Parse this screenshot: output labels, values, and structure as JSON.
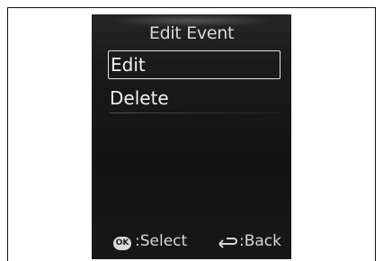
{
  "screen": {
    "title": "Edit Event",
    "menu": [
      {
        "label": "Edit",
        "selected": true
      },
      {
        "label": "Delete",
        "selected": false
      }
    ],
    "footer": {
      "ok_icon_text": "OK",
      "select_label": ":Select",
      "back_label": ":Back"
    }
  },
  "icons": [
    "ok-button-icon",
    "back-arrow-icon"
  ],
  "colors": {
    "screen_bg": "#171717",
    "text": "#f2f2f2",
    "selection_border": "#e6e6e6"
  }
}
